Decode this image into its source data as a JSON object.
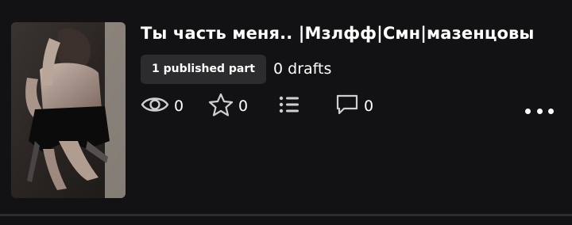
{
  "story": {
    "title": "Ты часть меня.. |Мзлфф|Смн|мазенцовы",
    "published_badge": "1 published part",
    "drafts": "0 drafts",
    "stats": {
      "views": "0",
      "votes": "0",
      "comments": "0"
    }
  },
  "icons": {
    "views": "eye-icon",
    "votes": "star-icon",
    "parts": "list-icon",
    "comments": "comment-icon",
    "menu": "more-horizontal-icon"
  },
  "colors": {
    "background": "#121113",
    "badge_bg": "#2c2b2e",
    "text": "#ffffff",
    "icon": "#cfcfd3"
  }
}
